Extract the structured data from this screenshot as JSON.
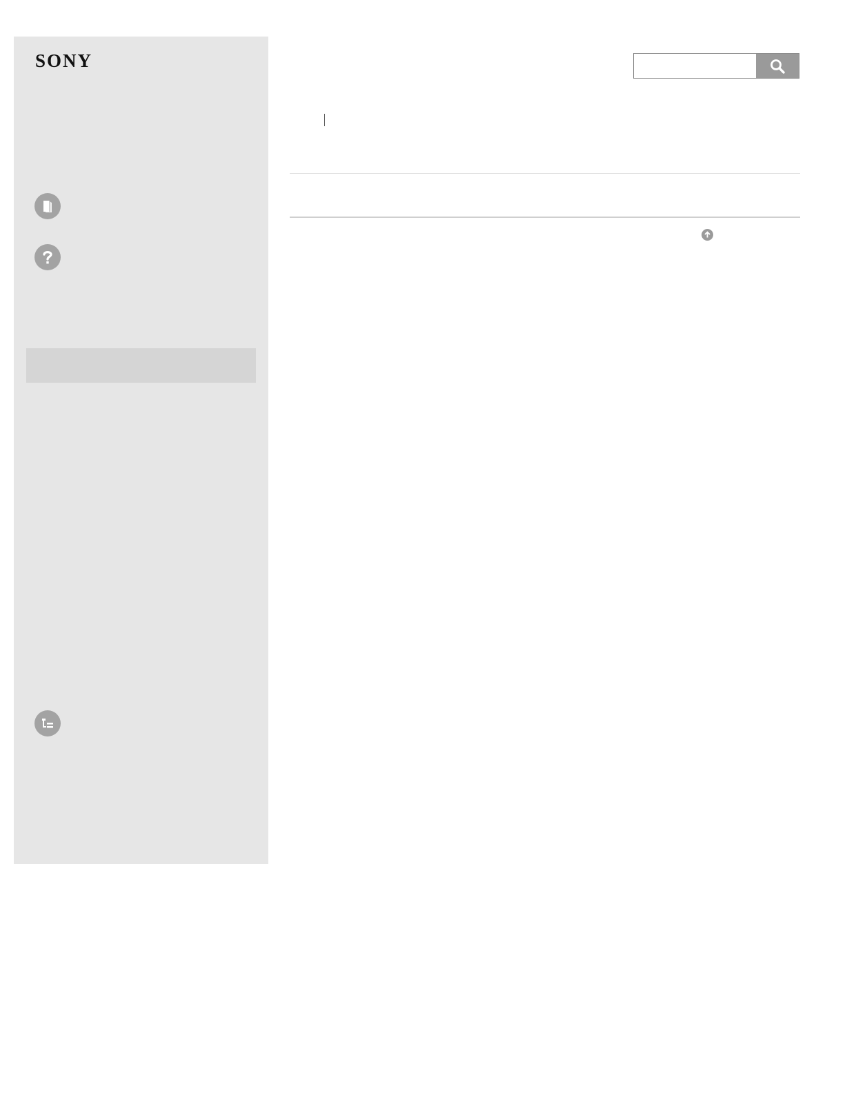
{
  "header": {
    "logo_text": "SONY",
    "search": {
      "value": "",
      "placeholder": "",
      "button_icon": "search-icon"
    }
  },
  "sidebar": {
    "nav_icons": [
      "manual-icon",
      "help-icon",
      "contents-icon"
    ]
  },
  "main": {
    "back_to_top_icon": "arrow-up-circle-icon"
  },
  "colors": {
    "sidebar_bg": "#e6e6e6",
    "sidebar_highlight": "#d5d5d5",
    "icon_gray": "#a3a3a3",
    "search_button_bg": "#9a9a9a"
  }
}
